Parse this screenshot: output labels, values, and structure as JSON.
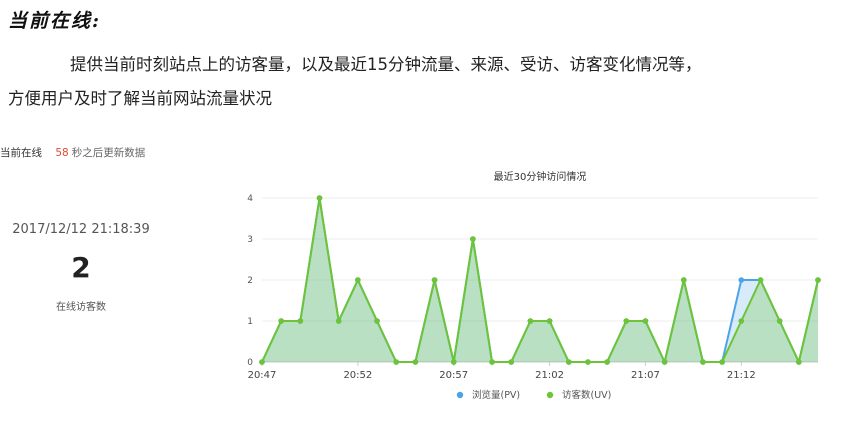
{
  "doc": {
    "title": "当前在线:",
    "paragraph_line1": "提供当前时刻站点上的访客量，以及最近15分钟流量、来源、受访、访客变化情况等，",
    "paragraph_line2": "方便用户及时了解当前网站流量状况"
  },
  "widget": {
    "header_title": "当前在线",
    "refresh_count": "58",
    "refresh_suffix": "秒之后更新数据",
    "timestamp": "2017/12/12 21:18:39",
    "online_number": "2",
    "online_label": "在线访客数"
  },
  "chart_data": {
    "type": "area",
    "title": "最近30分钟访问情况",
    "xlabel": "",
    "ylabel": "",
    "ylim": [
      0,
      4
    ],
    "y_ticks": [
      "0",
      "1",
      "2",
      "3",
      "4"
    ],
    "x_tick_labels": [
      "20:47",
      "20:52",
      "20:57",
      "21:02",
      "21:07",
      "21:12"
    ],
    "x_tick_indices": [
      0,
      5,
      10,
      15,
      20,
      25
    ],
    "grid": true,
    "legend_position": "bottom-center",
    "series": [
      {
        "name": "浏览量(PV)",
        "color": "#4da3e8",
        "values": [
          0,
          1,
          1,
          4,
          1,
          2,
          1,
          0,
          0,
          2,
          0,
          3,
          0,
          0,
          1,
          1,
          0,
          0,
          0,
          1,
          1,
          0,
          2,
          0,
          0,
          2,
          2,
          1,
          0,
          2
        ]
      },
      {
        "name": "访客数(UV)",
        "color": "#6cc436",
        "values": [
          0,
          1,
          1,
          4,
          1,
          2,
          1,
          0,
          0,
          2,
          0,
          3,
          0,
          0,
          1,
          1,
          0,
          0,
          0,
          1,
          1,
          0,
          2,
          0,
          0,
          1,
          2,
          1,
          0,
          2
        ]
      }
    ]
  }
}
